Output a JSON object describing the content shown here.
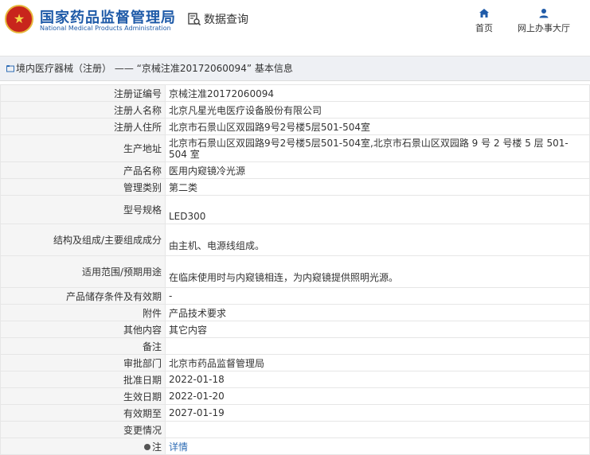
{
  "header": {
    "brand_cn": "国家药品监督管理局",
    "brand_en": "National Medical Products Administration",
    "query_label": "数据查询",
    "nav_home": "首页",
    "nav_online": "网上办事大厅"
  },
  "breadcrumb": "境内医疗器械（注册） —— “京械注准20172060094” 基本信息",
  "rows": [
    {
      "k": "注册证编号",
      "v": "京械注准20172060094"
    },
    {
      "k": "注册人名称",
      "v": "北京凡星光电医疗设备股份有限公司"
    },
    {
      "k": "注册人住所",
      "v": "北京市石景山区双园路9号2号楼5层501-504室"
    },
    {
      "k": "生产地址",
      "v": "北京市石景山区双园路9号2号楼5层501-504室,北京市石景山区双园路 9 号 2 号楼 5 层 501-504 室"
    },
    {
      "k": "产品名称",
      "v": "医用内窥镜冷光源"
    },
    {
      "k": "管理类别",
      "v": "第二类"
    },
    {
      "k": "型号规格",
      "v": "LED300"
    },
    {
      "k": "结构及组成/主要组成成分",
      "v": "由主机、电源线组成。"
    },
    {
      "k": "适用范围/预期用途",
      "v": "在临床使用时与内窥镜相连，为内窥镜提供照明光源。"
    },
    {
      "k": "产品储存条件及有效期",
      "v": "-"
    },
    {
      "k": "附件",
      "v": "产品技术要求"
    },
    {
      "k": "其他内容",
      "v": "其它内容"
    },
    {
      "k": "备注",
      "v": ""
    },
    {
      "k": "审批部门",
      "v": "北京市药品监督管理局"
    },
    {
      "k": "批准日期",
      "v": "2022-01-18"
    },
    {
      "k": "生效日期",
      "v": "2022-01-20"
    },
    {
      "k": "有效期至",
      "v": "2027-01-19"
    },
    {
      "k": "变更情况",
      "v": ""
    },
    {
      "k": "注",
      "v": "详情"
    }
  ]
}
